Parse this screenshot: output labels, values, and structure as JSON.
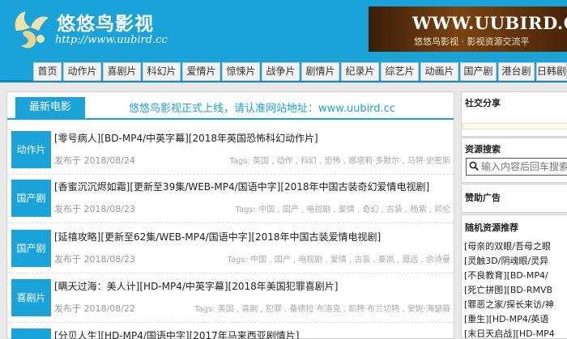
{
  "header": {
    "site_name": "悠悠鸟影视",
    "site_url": "http://www.uubird.cc",
    "banner_url": "WWW.UUBIRD.C",
    "banner_tagline": "悠悠鸟影视 · 影视资源交流平"
  },
  "nav": [
    "首页",
    "动作片",
    "喜剧片",
    "科幻片",
    "爱情片",
    "惊悚片",
    "战争片",
    "剧情片",
    "纪录片",
    "综艺片",
    "动画片",
    "国产剧",
    "港台剧",
    "日韩剧"
  ],
  "main": {
    "tab_label": "最新电影",
    "notice": "悠悠鸟影视正式上线，请认准网站地址：www.uubird.cc",
    "posts": [
      {
        "category": "动作片",
        "title": "[零号病人][BD-MP4/中英字幕][2018年英国恐怖科幻动作片]",
        "date": "发布于 2018/08/24",
        "tags": "Tags: 英国 , 动作 , 科幻 , 恐怖 , 娜塔莉·多默尔 , 马特·史密斯"
      },
      {
        "category": "国产剧",
        "title": "[香蜜沉沉烬如霜][更新至39集/WEB-MP4/国语中字][2018年中国古装奇幻爱情电视剧]",
        "date": "发布于 2018/08/23",
        "tags": "Tags: 中国 , 国产 , 电视剧 , 爱情 , 奇幻 , 古装 , 杨紫 , 邓伦"
      },
      {
        "category": "国产剧",
        "title": "[延禧攻略][更新至62集/WEB-MP4/国语中字][2018年中国古装爱情电视剧]",
        "date": "发布于 2018/08/23",
        "tags": "Tags: 中国 , 国产 , 电视剧 , 爱情 , 古装 , 秦岚 , 聂远 , 佘诗曼"
      },
      {
        "category": "喜剧片",
        "title": "[瞒天过海：美人计][HD-MP4/中英字幕][2018年美国犯罪喜剧片]",
        "date": "发布于 2018/08/22",
        "tags": "Tags: 美国 , 喜剧 , 犯罪 , 桑德拉·布洛克 , 凯特·布兰切特 , 安妮·海瑟薇"
      },
      {
        "category": "",
        "title": "[分贝人生][HD-MP4/国语中字][2017年马来西亚剧情片]",
        "date": "",
        "tags": ""
      }
    ]
  },
  "sidebar": {
    "share_title": "社交分享",
    "search_title": "资源搜索",
    "search_placeholder": "输入内容后回车搜索",
    "ad_title": "赞助广告",
    "random_title": "随机资源推荐",
    "random_items": [
      "[母亲的双眼/吾母之眼",
      "[灵触3D/阴魂眼/灵异",
      "[不良教育][BD-MP4/",
      "[死亡拼图][BD-RMVB",
      "[罪恶之家/探长来访/神",
      "[重生][HD-MP4/英语",
      "[末日天启战][HD-MP4"
    ]
  },
  "colors": {
    "brand": "#1aa3d9",
    "banner_bg": "#5a300c"
  }
}
